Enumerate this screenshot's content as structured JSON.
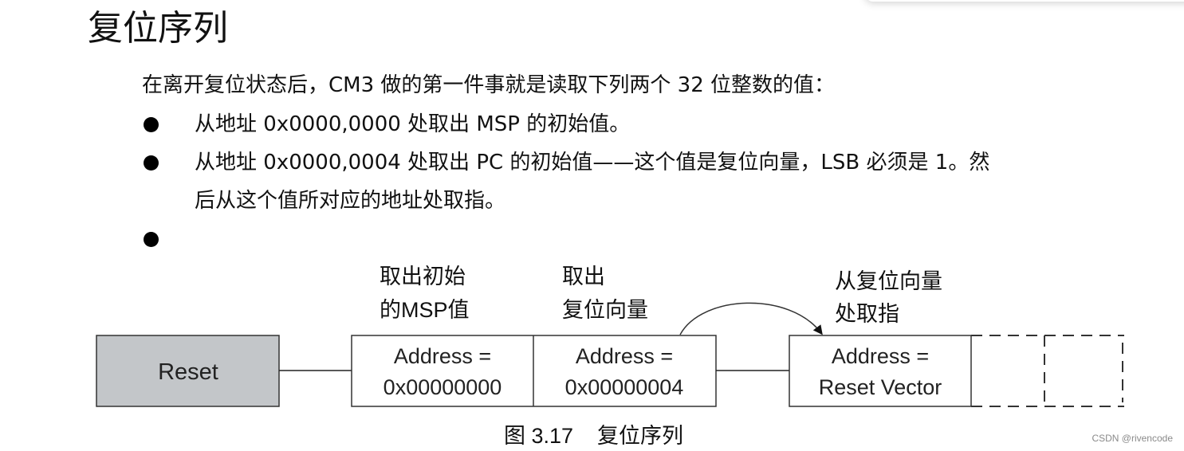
{
  "title": "复位序列",
  "intro": "在离开复位状态后，CM3 做的第一件事就是读取下列两个 32 位整数的值：",
  "bullets": [
    {
      "line1": "从地址 0x0000,0000 处取出 MSP 的初始值。",
      "line2": ""
    },
    {
      "line1": "从地址 0x0000,0004 处取出 PC 的初始值——这个值是复位向量，LSB 必须是 1。然",
      "line2": "后从这个值所对应的地址处取指。"
    },
    {
      "line1": "",
      "line2": ""
    }
  ],
  "diagram": {
    "reset_box": {
      "label": "Reset",
      "fill": "#c3c6c9"
    },
    "labels": {
      "fetch_msp_line1": "取出初始",
      "fetch_msp_line2": "的MSP值",
      "fetch_vector_line1": "取出",
      "fetch_vector_line2": "复位向量",
      "fetch_instr_line1": "从复位向量",
      "fetch_instr_line2": "处取指"
    },
    "boxes": [
      {
        "line1": "Address =",
        "line2": "0x00000000"
      },
      {
        "line1": "Address =",
        "line2": "0x00000004"
      },
      {
        "line1": "Address =",
        "line2": "Reset Vector"
      }
    ],
    "caption": "图 3.17    复位序列"
  },
  "watermark": "CSDN @rivencode"
}
